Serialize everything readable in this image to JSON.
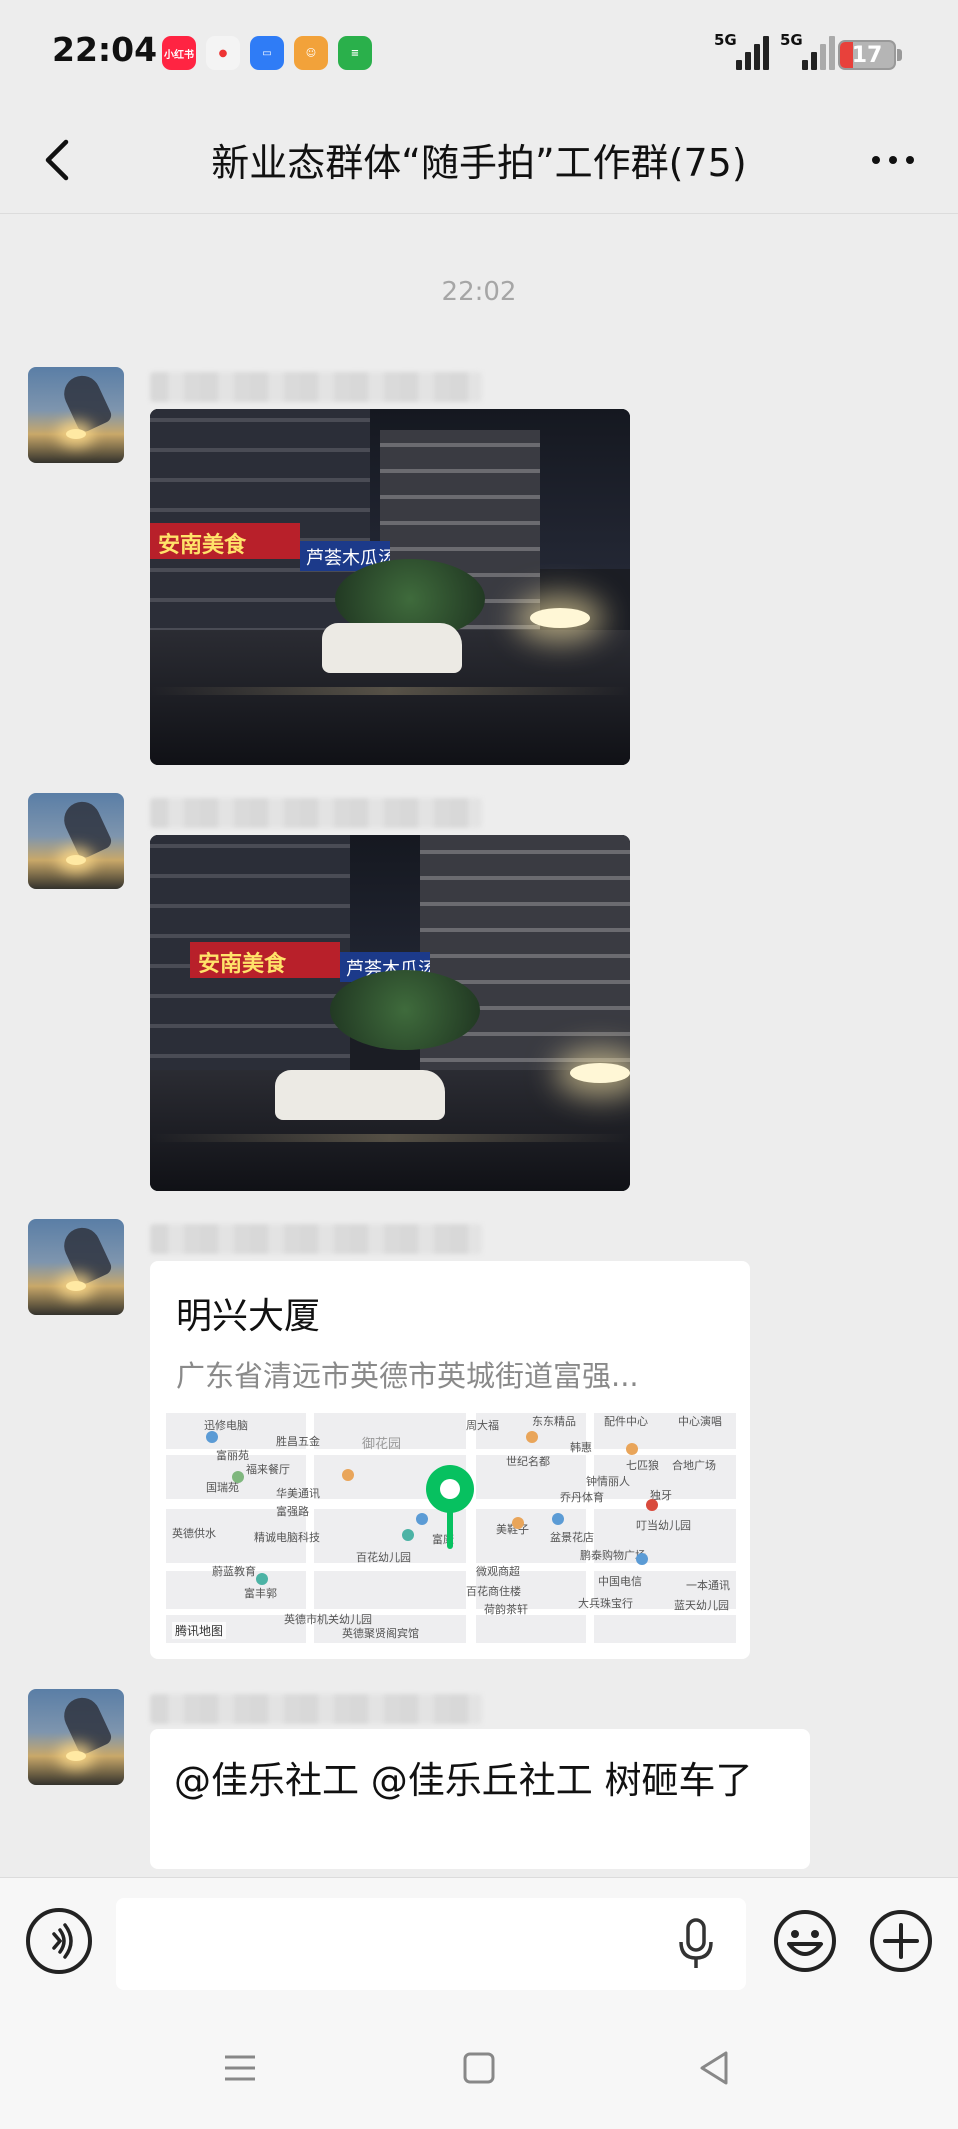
{
  "status_bar": {
    "time": "22:04",
    "app_icons": [
      "小红书",
      "地图",
      "文件",
      "游戏",
      "信息"
    ],
    "signal_1_label": "5G",
    "signal_2_label": "5G",
    "battery_level": "17"
  },
  "header": {
    "title": "新业态群体“随手拍”工作群(75)"
  },
  "chat": {
    "timestamp": "22:02",
    "messages": [
      {
        "type": "image",
        "sign_red": "安南美食",
        "sign_blue": "芦荟木瓜汤"
      },
      {
        "type": "image",
        "sign_red": "安南美食",
        "sign_blue": "芦荟木瓜汤"
      },
      {
        "type": "location",
        "name": "明兴大厦",
        "address": "广东省清远市英德市英城街道富强...",
        "map_labels": [
          "迅修电脑",
          "胜昌五金",
          "富丽苑",
          "福来餐厅",
          "国瑞苑",
          "华美通讯",
          "富强路",
          "英德供水",
          "精诚电脑科技",
          "百花幼儿园",
          "蔚蓝教育",
          "富丰郭",
          "英德市机关幼儿园",
          "英德聚贤阁宾馆",
          "世纪名都",
          "周大福",
          "东东精品",
          "配件中心",
          "中心演唱",
          "韩惠",
          "七匹狼",
          "合地广场",
          "乔丹体育",
          "钟情丽人",
          "独牙",
          "美鞋子",
          "盆景花店",
          "叮当幼儿园",
          "鹏泰购物广场",
          "中国电信",
          "百花商住楼",
          "荷韵茶轩",
          "大兵珠宝行",
          "一本通讯",
          "蓝天幼儿园",
          "富康",
          "微观商超",
          "御花园"
        ],
        "map_attribution": "腾讯地图"
      },
      {
        "type": "text",
        "text": "@佳乐社工 @佳乐丘社工  树砸车了"
      }
    ]
  },
  "input": {
    "placeholder": ""
  },
  "colors": {
    "background": "#ededed",
    "bubble": "#ffffff",
    "pin": "#07c160",
    "battery_low": "#e8413b"
  },
  "icons": {
    "back": "chevron-left-icon",
    "more": "more-dots-icon",
    "voice": "voice-icon",
    "mic": "microphone-icon",
    "emoji": "emoji-icon",
    "plus": "plus-icon"
  }
}
